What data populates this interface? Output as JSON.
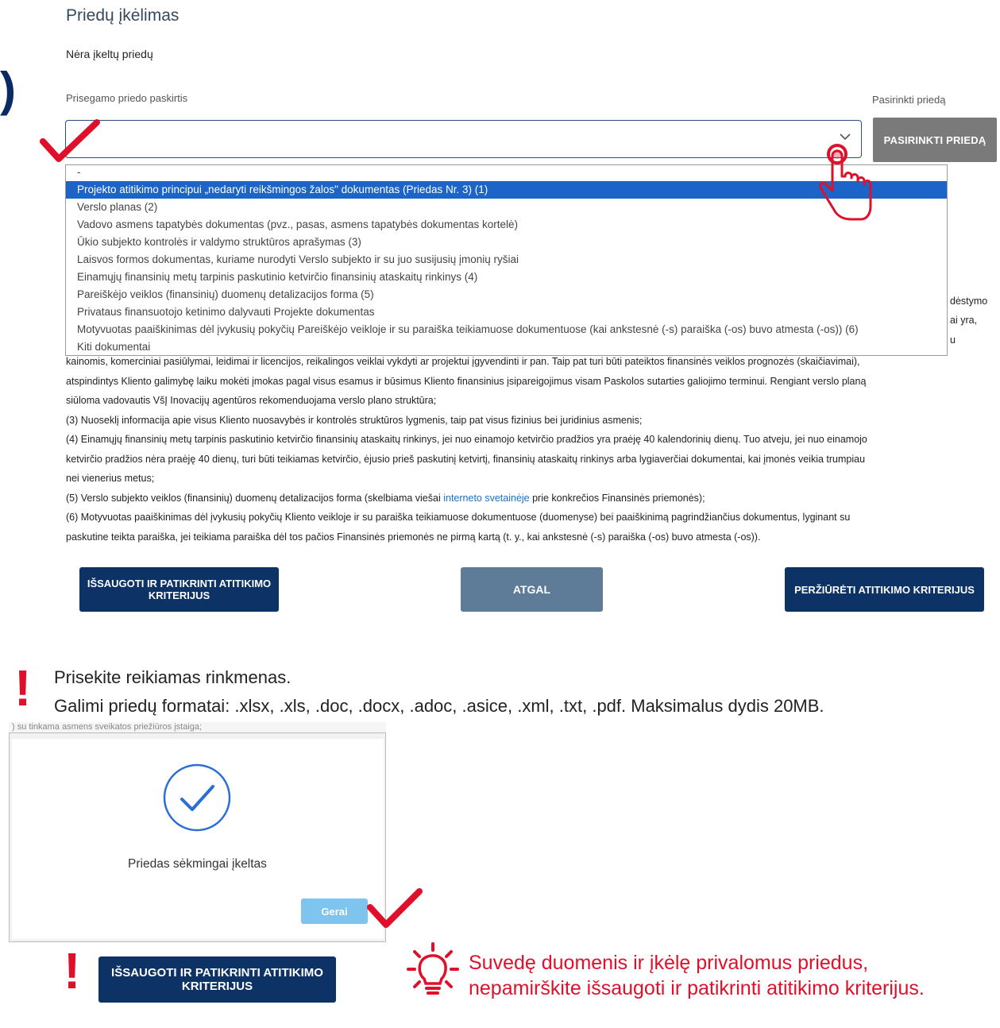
{
  "section": {
    "title": "Priedų įkėlimas",
    "no_attachments": "Nėra įkeltų priedų",
    "bracket": ")"
  },
  "attachment_form": {
    "purpose_label": "Prisegamo priedo paskirtis",
    "choose_label": "Pasirinkti priedą",
    "choose_button": "PASIRINKTI PRIEDĄ",
    "select_value": "",
    "options": [
      "-",
      "Projekto atitikimo principui „nedaryti reikšmingos žalos\" dokumentas (Priedas Nr. 3) (1)",
      "Verslo planas (2)",
      "Vadovo asmens tapatybės dokumentas (pvz., pasas, asmens tapatybės dokumentas kortelė)",
      "Ūkio subjekto kontrolės ir valdymo struktūros aprašymas (3)",
      "Laisvos formos dokumentas, kuriame nurodyti Verslo subjekto ir su juo susijusių įmonių ryšiai",
      "Einamųjų finansinių metų tarpinis paskutinio ketvirčio finansinių ataskaitų rinkinys (4)",
      "Pareiškėjo veiklos (finansinių) duomenų detalizacijos forma (5)",
      "Privataus finansuotojo ketinimo dalyvauti Projekte dokumentas",
      "Motyvuotas paaiškinimas dėl įvykusių pokyčių Pareiškėjo veikloje ir su paraiška teikiamuose dokumentuose (kai ankstesnė (-s) paraiška (-os) buvo atmesta (-os)) (6)",
      "Kiti dokumentai"
    ],
    "selected_index": 1
  },
  "side_fragments": [
    "dėstymo",
    "ai yra,",
    "u"
  ],
  "info": {
    "line0": "kainomis, komerciniai pasiūlymai, leidimai ir licencijos, reikalingos veiklai vykdyti ar projektui įgyvendinti ir pan. Taip pat turi būti pateiktos finansinės veiklos prognozės (skaičiavimai),",
    "line1": "atspindintys Kliento galimybę laiku mokėti įmokas pagal visus esamus ir būsimus Kliento finansinius įsipareigojimus visam Paskolos sutarties galiojimo terminui. Rengiant verslo planą",
    "line2": "siūloma vadovautis VšĮ Inovacijų agentūros rekomenduojama verslo plano struktūra;",
    "line3": "(3) Nuoseklį informacija apie visus Kliento nuosavybės ir kontrolės struktūros lygmenis, taip pat visus fizinius bei juridinius asmenis;",
    "line4": "(4) Einamųjų finansinių metų tarpinis paskutinio ketvirčio finansinių ataskaitų rinkinys, jei nuo einamojo ketvirčio pradžios yra praėję 40 kalendorinių dienų. Tuo atveju, jei nuo einamojo",
    "line5": "ketvirčio pradžios nėra praėję 40 dienų, turi būti teikiamas ketvirčio, ėjusio prieš paskutinį ketvirtį, finansinių ataskaitų rinkinys arba lygiaverčiai dokumentai, kai įmonės veikia trumpiau",
    "line6": "nei vienerius metus;",
    "line7_before": "(5) Verslo subjekto veiklos (finansinių) duomenų detalizacijos forma (skelbiama viešai ",
    "line7_link": "interneto svetainėje",
    "line7_after": " prie konkrečios Finansinės priemonės);",
    "line8": "(6) Motyvuotas paaiškinimas dėl įvykusių pokyčių Kliento veikloje ir su paraiška teikiamuose dokumentuose (duomenyse) bei paaiškinimą pagrindžiančius dokumentus, lyginant su",
    "line9": "paskutine teikta paraiška, jei teikiama paraiška dėl tos pačios Finansinės priemonės ne pirmą kartą (t. y., kai ankstesnė (-s) paraiška (-os) buvo atmesta (-os))."
  },
  "actions": {
    "save_check": "IŠSAUGOTI IR PATIKRINTI ATITIKIMO KRITERIJUS",
    "back": "ATGAL",
    "view_criteria": "PERŽIŪRĖTI ATITIKIMO KRITERIJUS"
  },
  "warning": {
    "mark": "!",
    "line1": "Prisekite reikiamas rinkmenas.",
    "line2": "Galimi priedų formatai: .xlsx, .xls, .doc, .docx, .adoc, .asice, .xml, .txt, .pdf. Maksimalus dydis 20MB."
  },
  "modal": {
    "behind_text": ") su tinkama asmens sveikatos priežiūros įstaiga;",
    "message": "Priedas sėkmingai įkeltas",
    "ok_button": "Gerai"
  },
  "bottom": {
    "mark": "!",
    "save_check": "IŠSAUGOTI IR PATIKRINTI ATITIKIMO KRITERIJUS",
    "tip": "Suvedę duomenis ir įkėlę privalomus priedus, nepamirškite išsaugoti ir patikrinti atitikimo kriterijus."
  },
  "colors": {
    "navy": "#0c3266",
    "gray_button": "#7a7a7a",
    "slate_button": "#5e7c98",
    "selected_option": "#1c64c8",
    "annotation_red": "#e0102a",
    "ok_button": "#7ec4ee",
    "check_blue": "#2a6fd6"
  },
  "icons": [
    "check-mark-icon",
    "chevron-down-icon",
    "pointing-hand-icon",
    "success-check-icon",
    "lightbulb-icon"
  ]
}
